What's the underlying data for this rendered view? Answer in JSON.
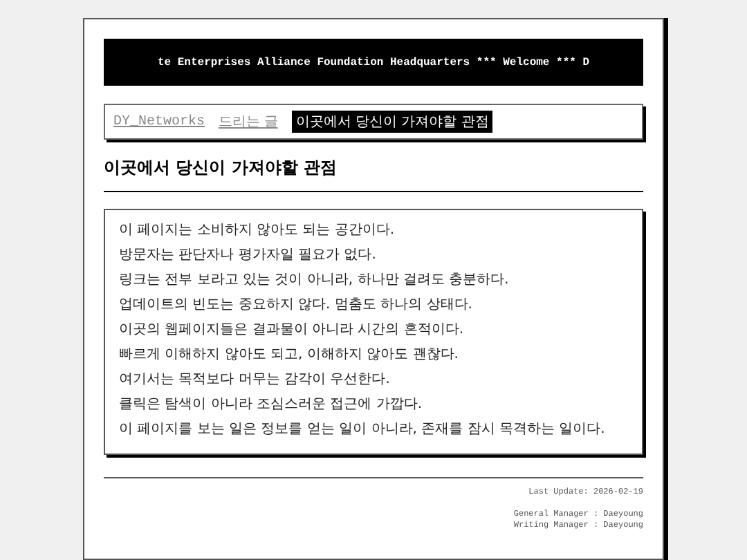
{
  "banner": {
    "text": "te Enterprises Alliance Foundation Headquarters *** Welcome *** D"
  },
  "breadcrumb": [
    {
      "label": "DY_Networks",
      "kind": "link"
    },
    {
      "label": "드리는 글",
      "kind": "link"
    },
    {
      "label": "이곳에서 당신이 가져야할 관점",
      "kind": "current"
    }
  ],
  "title": "이곳에서 당신이 가져야할 관점",
  "paragraphs": [
    "이 페이지는 소비하지 않아도 되는 공간이다.",
    "방문자는 판단자나 평가자일 필요가 없다.",
    "링크는 전부 보라고 있는 것이 아니라, 하나만 걸려도 충분하다.",
    "업데이트의 빈도는 중요하지 않다. 멈춤도 하나의 상태다.",
    "이곳의 웹페이지들은 결과물이 아니라 시간의 흔적이다.",
    "빠르게 이해하지 않아도 되고, 이해하지 않아도 괜찮다.",
    "여기서는 목적보다 머무는 감각이 우선한다.",
    "클릭은 탐색이 아니라 조심스러운 접근에 가깝다.",
    "이 페이지를 보는 일은 정보를 얻는 일이 아니라, 존재를 잠시 목격하는 일이다."
  ],
  "footer": {
    "last_update": "Last Update: 2026-02-19",
    "credits": [
      "General Manager : Daeyoung",
      "Writing Manager : Daeyoung"
    ]
  }
}
